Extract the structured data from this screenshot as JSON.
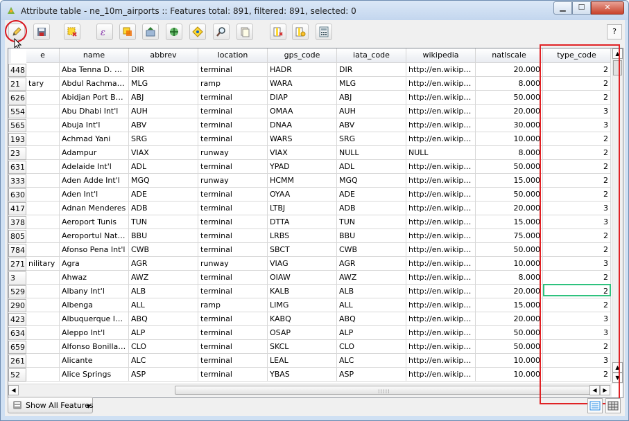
{
  "window": {
    "title": "Attribute table - ne_10m_airports :: Features total: 891, filtered: 891, selected: 0"
  },
  "toolbar": {
    "help_label": "?"
  },
  "table": {
    "columns": [
      "e",
      "name",
      "abbrev",
      "location",
      "gps_code",
      "iata_code",
      "wikipedia",
      "natlscale",
      "type_code"
    ],
    "rows": [
      {
        "id": "448",
        "e": "",
        "name": "Aba Tenna D. Yil...",
        "abbrev": "DIR",
        "location": "terminal",
        "gps_code": "HADR",
        "iata_code": "DIR",
        "wikipedia": "http://en.wikiped...",
        "natlscale": "20.000",
        "type_code": "2"
      },
      {
        "id": "21",
        "e": "tary",
        "name": "Abdul Rachman S...",
        "abbrev": "MLG",
        "location": "ramp",
        "gps_code": "WARA",
        "iata_code": "MLG",
        "wikipedia": "http://en.wikiped...",
        "natlscale": "8.000",
        "type_code": "2"
      },
      {
        "id": "626",
        "e": "",
        "name": "Abidjan Port Bouet",
        "abbrev": "ABJ",
        "location": "terminal",
        "gps_code": "DIAP",
        "iata_code": "ABJ",
        "wikipedia": "http://en.wikiped...",
        "natlscale": "50.000",
        "type_code": "2"
      },
      {
        "id": "554",
        "e": "",
        "name": "Abu Dhabi Int'l",
        "abbrev": "AUH",
        "location": "terminal",
        "gps_code": "OMAA",
        "iata_code": "AUH",
        "wikipedia": "http://en.wikiped...",
        "natlscale": "20.000",
        "type_code": "3"
      },
      {
        "id": "565",
        "e": "",
        "name": "Abuja Int'l",
        "abbrev": "ABV",
        "location": "terminal",
        "gps_code": "DNAA",
        "iata_code": "ABV",
        "wikipedia": "http://en.wikiped...",
        "natlscale": "30.000",
        "type_code": "3"
      },
      {
        "id": "193",
        "e": "",
        "name": "Achmad Yani",
        "abbrev": "SRG",
        "location": "terminal",
        "gps_code": "WARS",
        "iata_code": "SRG",
        "wikipedia": "http://en.wikiped...",
        "natlscale": "10.000",
        "type_code": "2"
      },
      {
        "id": "23",
        "e": "",
        "name": "Adampur",
        "abbrev": "VIAX",
        "location": "runway",
        "gps_code": "VIAX",
        "iata_code": "NULL",
        "wikipedia": "NULL",
        "natlscale": "8.000",
        "type_code": "2"
      },
      {
        "id": "631",
        "e": "",
        "name": "Adelaide Int'l",
        "abbrev": "ADL",
        "location": "terminal",
        "gps_code": "YPAD",
        "iata_code": "ADL",
        "wikipedia": "http://en.wikiped...",
        "natlscale": "50.000",
        "type_code": "2"
      },
      {
        "id": "333",
        "e": "",
        "name": "Aden Adde Int'l",
        "abbrev": "MGQ",
        "location": "runway",
        "gps_code": "HCMM",
        "iata_code": "MGQ",
        "wikipedia": "http://en.wikiped...",
        "natlscale": "15.000",
        "type_code": "2"
      },
      {
        "id": "630",
        "e": "",
        "name": "Aden Int'l",
        "abbrev": "ADE",
        "location": "terminal",
        "gps_code": "OYAA",
        "iata_code": "ADE",
        "wikipedia": "http://en.wikiped...",
        "natlscale": "50.000",
        "type_code": "2"
      },
      {
        "id": "417",
        "e": "",
        "name": "Adnan Menderes",
        "abbrev": "ADB",
        "location": "terminal",
        "gps_code": "LTBJ",
        "iata_code": "ADB",
        "wikipedia": "http://en.wikiped...",
        "natlscale": "20.000",
        "type_code": "3"
      },
      {
        "id": "378",
        "e": "",
        "name": "Aeroport Tunis",
        "abbrev": "TUN",
        "location": "terminal",
        "gps_code": "DTTA",
        "iata_code": "TUN",
        "wikipedia": "http://en.wikiped...",
        "natlscale": "15.000",
        "type_code": "3"
      },
      {
        "id": "805",
        "e": "",
        "name": "Aeroportul Natio...",
        "abbrev": "BBU",
        "location": "terminal",
        "gps_code": "LRBS",
        "iata_code": "BBU",
        "wikipedia": "http://en.wikiped...",
        "natlscale": "75.000",
        "type_code": "2"
      },
      {
        "id": "784",
        "e": "",
        "name": "Afonso Pena Int'l",
        "abbrev": "CWB",
        "location": "terminal",
        "gps_code": "SBCT",
        "iata_code": "CWB",
        "wikipedia": "http://en.wikiped...",
        "natlscale": "50.000",
        "type_code": "2"
      },
      {
        "id": "271",
        "e": "nilitary",
        "name": "Agra",
        "abbrev": "AGR",
        "location": "runway",
        "gps_code": "VIAG",
        "iata_code": "AGR",
        "wikipedia": "http://en.wikiped...",
        "natlscale": "10.000",
        "type_code": "3"
      },
      {
        "id": "3",
        "e": "",
        "name": "Ahwaz",
        "abbrev": "AWZ",
        "location": "terminal",
        "gps_code": "OIAW",
        "iata_code": "AWZ",
        "wikipedia": "http://en.wikiped...",
        "natlscale": "8.000",
        "type_code": "2"
      },
      {
        "id": "529",
        "e": "",
        "name": "Albany Int'l",
        "abbrev": "ALB",
        "location": "terminal",
        "gps_code": "KALB",
        "iata_code": "ALB",
        "wikipedia": "http://en.wikiped...",
        "natlscale": "20.000",
        "type_code": "2"
      },
      {
        "id": "290",
        "e": "",
        "name": "Albenga",
        "abbrev": "ALL",
        "location": "ramp",
        "gps_code": "LIMG",
        "iata_code": "ALL",
        "wikipedia": "http://en.wikiped...",
        "natlscale": "15.000",
        "type_code": "2"
      },
      {
        "id": "423",
        "e": "",
        "name": "Albuquerque Int'l",
        "abbrev": "ABQ",
        "location": "terminal",
        "gps_code": "KABQ",
        "iata_code": "ABQ",
        "wikipedia": "http://en.wikiped...",
        "natlscale": "20.000",
        "type_code": "3"
      },
      {
        "id": "634",
        "e": "",
        "name": "Aleppo Int'l",
        "abbrev": "ALP",
        "location": "terminal",
        "gps_code": "OSAP",
        "iata_code": "ALP",
        "wikipedia": "http://en.wikiped...",
        "natlscale": "50.000",
        "type_code": "3"
      },
      {
        "id": "659",
        "e": "",
        "name": "Alfonso Bonilla Ar...",
        "abbrev": "CLO",
        "location": "terminal",
        "gps_code": "SKCL",
        "iata_code": "CLO",
        "wikipedia": "http://en.wikiped...",
        "natlscale": "50.000",
        "type_code": "2"
      },
      {
        "id": "261",
        "e": "",
        "name": "Alicante",
        "abbrev": "ALC",
        "location": "terminal",
        "gps_code": "LEAL",
        "iata_code": "ALC",
        "wikipedia": "http://en.wikiped...",
        "natlscale": "10.000",
        "type_code": "3"
      },
      {
        "id": "52",
        "e": "",
        "name": "Alice Springs",
        "abbrev": "ASP",
        "location": "terminal",
        "gps_code": "YBAS",
        "iata_code": "ASP",
        "wikipedia": "http://en.wikiped...",
        "natlscale": "10.000",
        "type_code": "2"
      }
    ]
  },
  "bottom": {
    "show_all_label": "Show All Features"
  },
  "colors": {
    "highlight_red": "#e02225",
    "selected_cell": "#2ec27e",
    "title_bar": "#c3d6ee"
  }
}
